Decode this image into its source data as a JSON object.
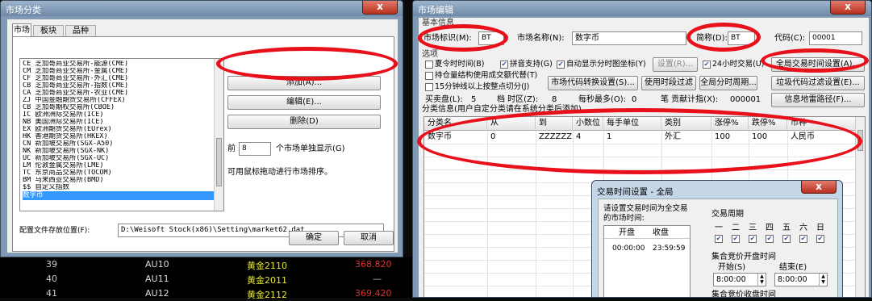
{
  "bg_table": {
    "rows": [
      {
        "num": "39",
        "code": "AU10",
        "name": "黄金2110",
        "price": "368.820",
        "price_color": "#e03030"
      },
      {
        "num": "40",
        "code": "AU11",
        "name": "黄金2011",
        "price": "—",
        "price_color": "#bbbbbb"
      },
      {
        "num": "41",
        "code": "AU12",
        "name": "黄金2112",
        "price": "369.420",
        "price_color": "#e03030"
      }
    ]
  },
  "win1": {
    "title": "市场分类",
    "close": "x",
    "tabs": [
      "市场",
      "板块",
      "品种"
    ],
    "list": [
      "CE 芝加哥商业交易所-能源(CME)",
      "CM 芝加哥商业交易所-金属(CME)",
      "CF 芝加哥商业交易所-外汇(CME)",
      "CB 芝加哥商业交易所-指数(CME)",
      "CA 芝加哥商业交易所-农业(CME)",
      "ZJ 中国金融期货交易所(CFFEX)",
      "CB 芝加哥期权交易所(CBOE)",
      "IC 欧洲洲际交易所(ICE)",
      "NB 美国洲际交易所(ICE)",
      "EX 欧洲期货交易所(EUrex)",
      "HK 香港期货交易所(HKEX)",
      "CN 新加坡交易所(SGX-A50)",
      "NK 新加坡交易所(SGX-NK)",
      "UC 新加坡交易所(SGX-UC)",
      "LM 伦敦金属交易所(LME)",
      "TC 东京商品交易所(TOCOM)",
      "BM 马来西亚交易所(BMD)",
      "$$ 自定义指数",
      "数字币"
    ],
    "selected": "数字币",
    "add": "添加(A)...",
    "edit": "编辑(E)...",
    "delete": "删除(D)",
    "front_label": "前",
    "front_value": "8",
    "front_suffix": "个市场单独显示(G)",
    "drag_hint": "可用鼠标拖动进行市场排序。",
    "config_label": "配置文件存放位置(F):",
    "config_path": "D:\\Weisoft Stock(x86)\\Setting\\market62.dat",
    "ok": "确定",
    "cancel": "取消"
  },
  "win2": {
    "title": "市场编辑",
    "close": "x",
    "basic": "基本信息",
    "market_id_label": "市场标识(M):",
    "market_id": "BT",
    "market_name_label": "市场名称(N):",
    "market_name": "数字币",
    "abbr_label": "简称(D):",
    "abbr": "BT",
    "code_label": "代码(C):",
    "code": "00001",
    "options": "选项",
    "cb_split": {
      "label": "夏令时时间(B)",
      "checked": false
    },
    "cb_pinyin": {
      "label": "拼音支持(G)",
      "checked": true
    },
    "cb_autocoord": {
      "label": "自动显示分时图坐标(Y)",
      "checked": true
    },
    "btn_settings": "设置(R)...",
    "cb_24h": {
      "label": "24小时交易(U)",
      "checked": true
    },
    "btn_global_time": "全局交易时间设置(A)...",
    "cb_position": {
      "label": "持仓量结构使用成交额代替(T)",
      "checked": false
    },
    "btn_code_convert": "市场代码转换设置(S)...",
    "btn_period_filter": "使用时段过滤",
    "btn_global_period": "全局分时周期...",
    "btn_junk_filter": "垃圾代码过滤设置(E)...",
    "cb_15min": {
      "label": "15分钟线以上按整点切分(J)",
      "checked": false
    },
    "bid_label": "买卖盘(L):",
    "bid": "5",
    "tz_label": "档  时区(Z):",
    "tz": "8",
    "ms_label": "每秒最多(O):",
    "ms": "0",
    "contrib_label": "笔  贡献计指(X):",
    "contrib": "000001",
    "btn_info_mine": "信息地雷路径(F)...",
    "class_header": "分类信息(用户自定分类请在系统分类后添加)",
    "columns": [
      "分类名",
      "从",
      "到",
      "小数位",
      "每手单位",
      "类别",
      "涨停%",
      "跌停%",
      "币种"
    ],
    "rows": [
      [
        "数字币",
        "0",
        "ZZZZZZ",
        "4",
        "1",
        "外汇",
        "100",
        "100",
        "人民币"
      ]
    ]
  },
  "win3": {
    "title": "交易时间设置 - 全局",
    "close": "x",
    "desc": "请设置交易时间为全交易的市场时间:",
    "col_open": "开盘",
    "col_close": "收盘",
    "session_open": "00:00:00",
    "session_close": "23:59:59",
    "weekday_title": "交易周期",
    "weekdays": [
      "一",
      "二",
      "三",
      "四",
      "五",
      "六",
      "日"
    ],
    "call_auction_open": "集合竞价开盘时间",
    "start_label": "开始(S)",
    "end_label": "结束(E)",
    "start_val": "8:00:00",
    "end_val": "8:00:00",
    "call_auction_close": "集合竞价收盘时间"
  },
  "colors": {
    "highlight": "#3399ff",
    "ring": "#e8101a"
  }
}
